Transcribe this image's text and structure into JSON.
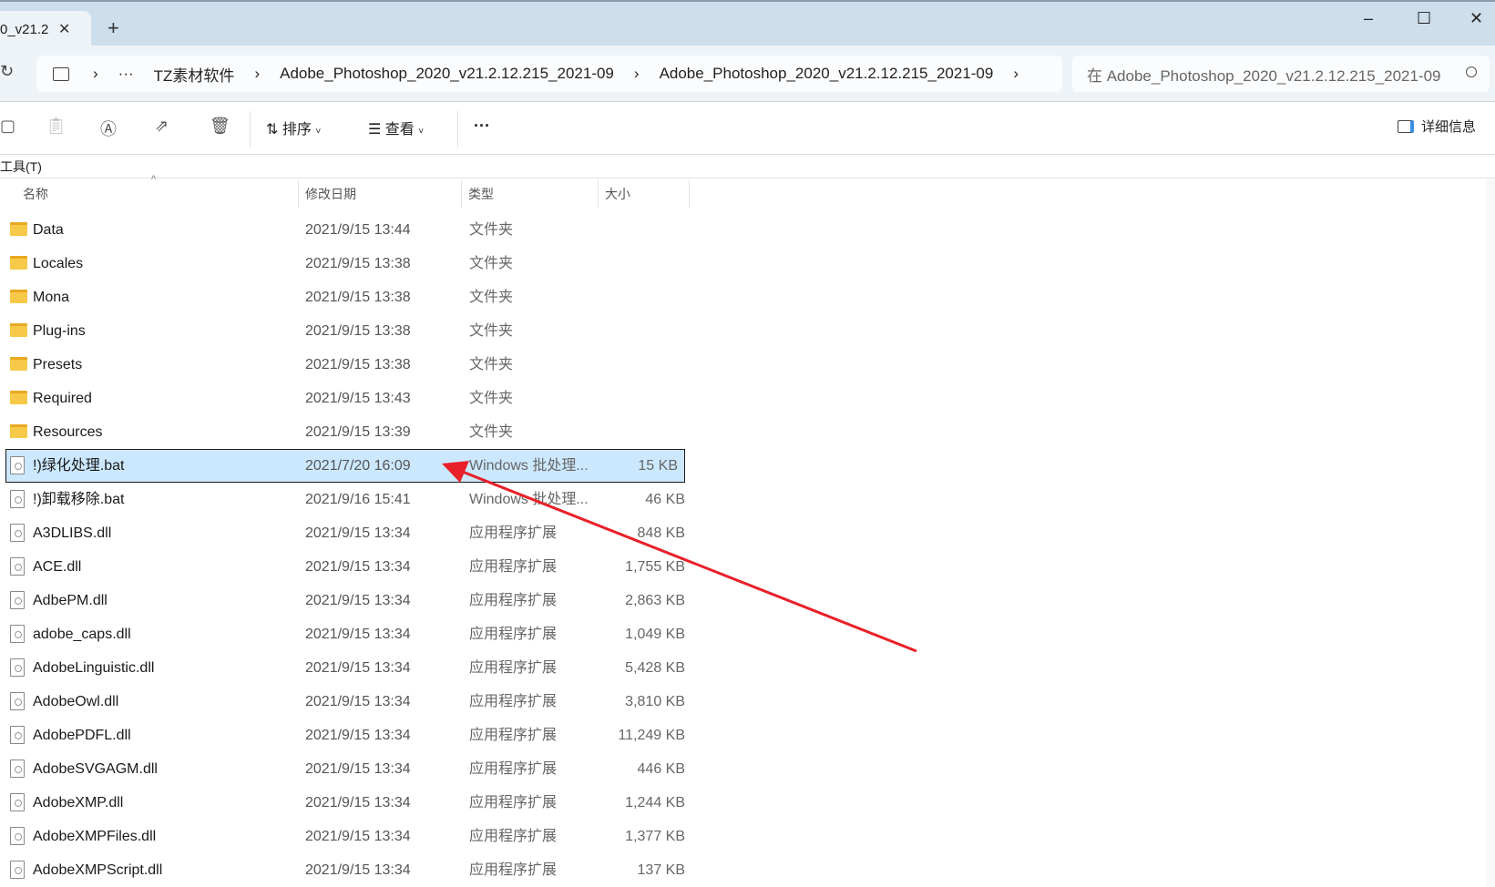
{
  "window": {
    "tab_title": "0_v21.2",
    "new_tab": "+",
    "minimize": "–",
    "maximize": "☐",
    "close": "✕"
  },
  "address": {
    "refresh": "↻",
    "crumbs": [
      "TZ素材软件",
      "Adobe_Photoshop_2020_v21.2.12.215_2021-09",
      "Adobe_Photoshop_2020_v21.2.12.215_2021-09"
    ],
    "ellipsis": "···",
    "sep": "›"
  },
  "search": {
    "placeholder": "在 Adobe_Photoshop_2020_v21.2.12.215_2021-09"
  },
  "toolbar": {
    "sort": "排序",
    "view": "查看",
    "more": "···",
    "details": "详细信息"
  },
  "menubar": {
    "tools": "工具(T)"
  },
  "columns": {
    "name": "名称",
    "date": "修改日期",
    "type": "类型",
    "size": "大小"
  },
  "files": [
    {
      "name": "Data",
      "date": "2021/9/15 13:44",
      "type": "文件夹",
      "size": "",
      "kind": "folder"
    },
    {
      "name": "Locales",
      "date": "2021/9/15 13:38",
      "type": "文件夹",
      "size": "",
      "kind": "folder"
    },
    {
      "name": "Mona",
      "date": "2021/9/15 13:38",
      "type": "文件夹",
      "size": "",
      "kind": "folder"
    },
    {
      "name": "Plug-ins",
      "date": "2021/9/15 13:38",
      "type": "文件夹",
      "size": "",
      "kind": "folder"
    },
    {
      "name": "Presets",
      "date": "2021/9/15 13:38",
      "type": "文件夹",
      "size": "",
      "kind": "folder"
    },
    {
      "name": "Required",
      "date": "2021/9/15 13:43",
      "type": "文件夹",
      "size": "",
      "kind": "folder"
    },
    {
      "name": "Resources",
      "date": "2021/9/15 13:39",
      "type": "文件夹",
      "size": "",
      "kind": "folder"
    },
    {
      "name": "!)绿化处理.bat",
      "date": "2021/7/20 16:09",
      "type": "Windows 批处理...",
      "size": "15 KB",
      "kind": "file",
      "selected": true
    },
    {
      "name": "!)卸载移除.bat",
      "date": "2021/9/16 15:41",
      "type": "Windows 批处理...",
      "size": "46 KB",
      "kind": "file"
    },
    {
      "name": "A3DLIBS.dll",
      "date": "2021/9/15 13:34",
      "type": "应用程序扩展",
      "size": "848 KB",
      "kind": "file"
    },
    {
      "name": "ACE.dll",
      "date": "2021/9/15 13:34",
      "type": "应用程序扩展",
      "size": "1,755 KB",
      "kind": "file"
    },
    {
      "name": "AdbePM.dll",
      "date": "2021/9/15 13:34",
      "type": "应用程序扩展",
      "size": "2,863 KB",
      "kind": "file"
    },
    {
      "name": "adobe_caps.dll",
      "date": "2021/9/15 13:34",
      "type": "应用程序扩展",
      "size": "1,049 KB",
      "kind": "file"
    },
    {
      "name": "AdobeLinguistic.dll",
      "date": "2021/9/15 13:34",
      "type": "应用程序扩展",
      "size": "5,428 KB",
      "kind": "file"
    },
    {
      "name": "AdobeOwl.dll",
      "date": "2021/9/15 13:34",
      "type": "应用程序扩展",
      "size": "3,810 KB",
      "kind": "file"
    },
    {
      "name": "AdobePDFL.dll",
      "date": "2021/9/15 13:34",
      "type": "应用程序扩展",
      "size": "11,249 KB",
      "kind": "file"
    },
    {
      "name": "AdobeSVGAGM.dll",
      "date": "2021/9/15 13:34",
      "type": "应用程序扩展",
      "size": "446 KB",
      "kind": "file"
    },
    {
      "name": "AdobeXMP.dll",
      "date": "2021/9/15 13:34",
      "type": "应用程序扩展",
      "size": "1,244 KB",
      "kind": "file"
    },
    {
      "name": "AdobeXMPFiles.dll",
      "date": "2021/9/15 13:34",
      "type": "应用程序扩展",
      "size": "1,377 KB",
      "kind": "file"
    },
    {
      "name": "AdobeXMPScript.dll",
      "date": "2021/9/15 13:34",
      "type": "应用程序扩展",
      "size": "137 KB",
      "kind": "file"
    }
  ],
  "colors": {
    "selection": "#cce8ff",
    "annotation_arrow": "#e8202a",
    "titlebar": "#cddeec"
  }
}
